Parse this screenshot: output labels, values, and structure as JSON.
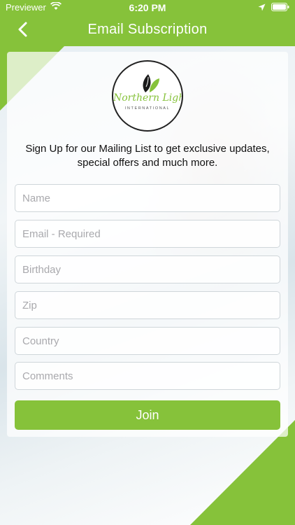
{
  "status_bar": {
    "carrier": "Previewer",
    "time": "6:20 PM"
  },
  "header": {
    "title": "Email Subscription"
  },
  "colors": {
    "brand_green": "#86c23a",
    "white": "#ffffff"
  },
  "intro_text": "Sign Up for our Mailing List to get exclusive updates, special offers and much more.",
  "form": {
    "fields": [
      {
        "placeholder": "Name"
      },
      {
        "placeholder": "Email - Required"
      },
      {
        "placeholder": "Birthday"
      },
      {
        "placeholder": "Zip"
      },
      {
        "placeholder": "Country"
      },
      {
        "placeholder": "Comments"
      }
    ],
    "submit_label": "Join"
  }
}
